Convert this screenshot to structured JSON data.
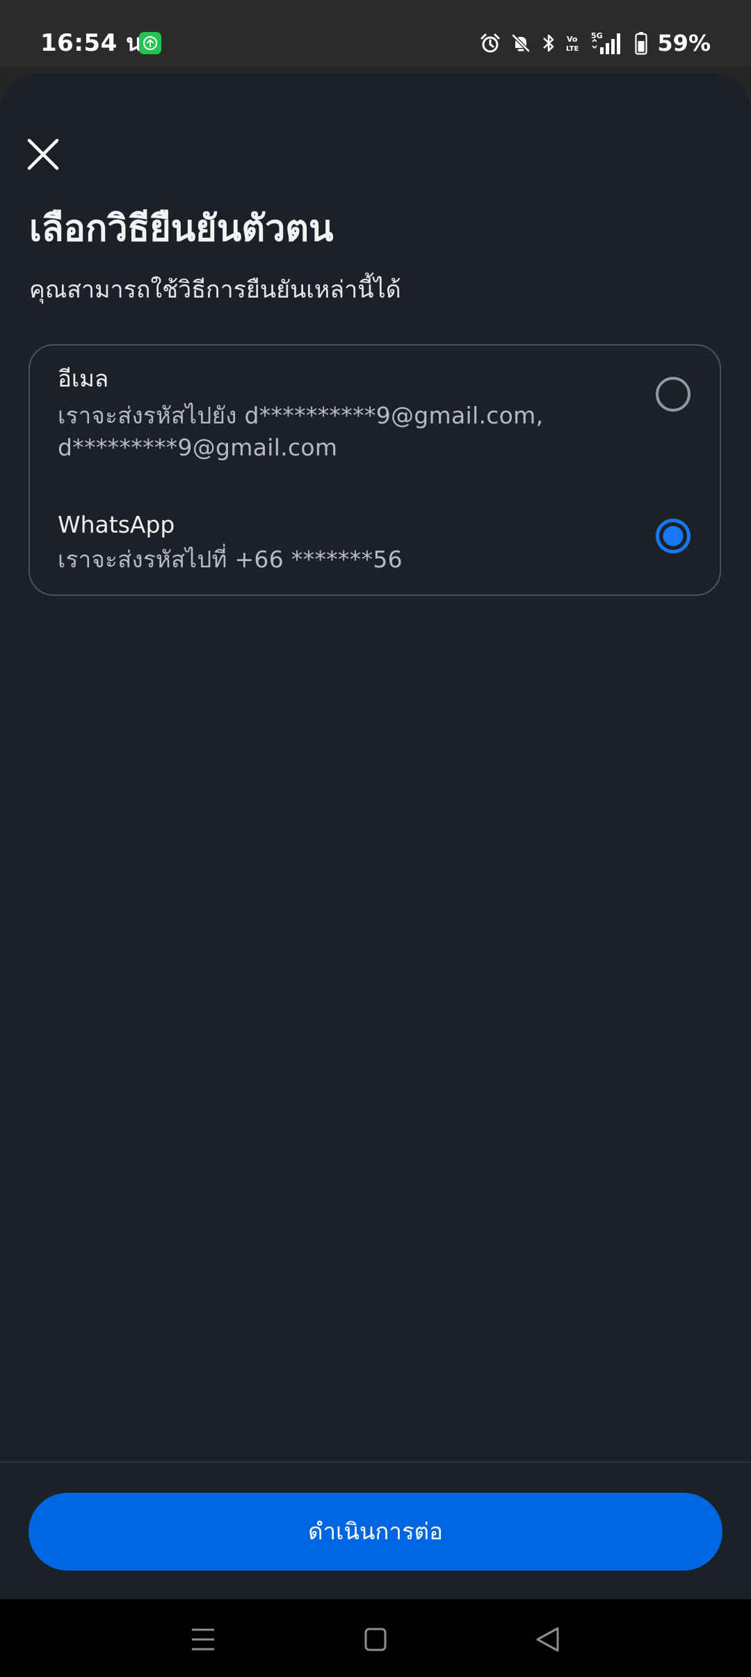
{
  "status_bar": {
    "time": "16:54 น.",
    "battery_percent": "59%",
    "network": "5G",
    "app_icon": "upload-arrow-icon",
    "icons": [
      "alarm-icon",
      "mute-icon",
      "bluetooth-icon",
      "volte-icon",
      "signal-icon",
      "battery-icon"
    ]
  },
  "sheet": {
    "close_icon": "close-icon",
    "title": "เลือกวิธียืนยันตัวตน",
    "subtitle": "คุณสามารถใช้วิธีการยืนยันเหล่านี้ได้"
  },
  "options": [
    {
      "title": "อีเมล",
      "description": "เราจะส่งรหัสไปยัง d**********9@gmail.com, d*********9@gmail.com",
      "selected": false
    },
    {
      "title": "WhatsApp",
      "description": "เราจะส่งรหัสไปที่ +66 *******56",
      "selected": true
    }
  ],
  "footer": {
    "continue_label": "ดำเนินการต่อ"
  },
  "nav_bar": {
    "icons": [
      "recents-icon",
      "home-icon",
      "back-icon"
    ]
  },
  "colors": {
    "accent": "#0066e0",
    "radio_selected": "#1877f2",
    "sheet_background": "#1a2127",
    "status_background": "#2a2b2d"
  }
}
